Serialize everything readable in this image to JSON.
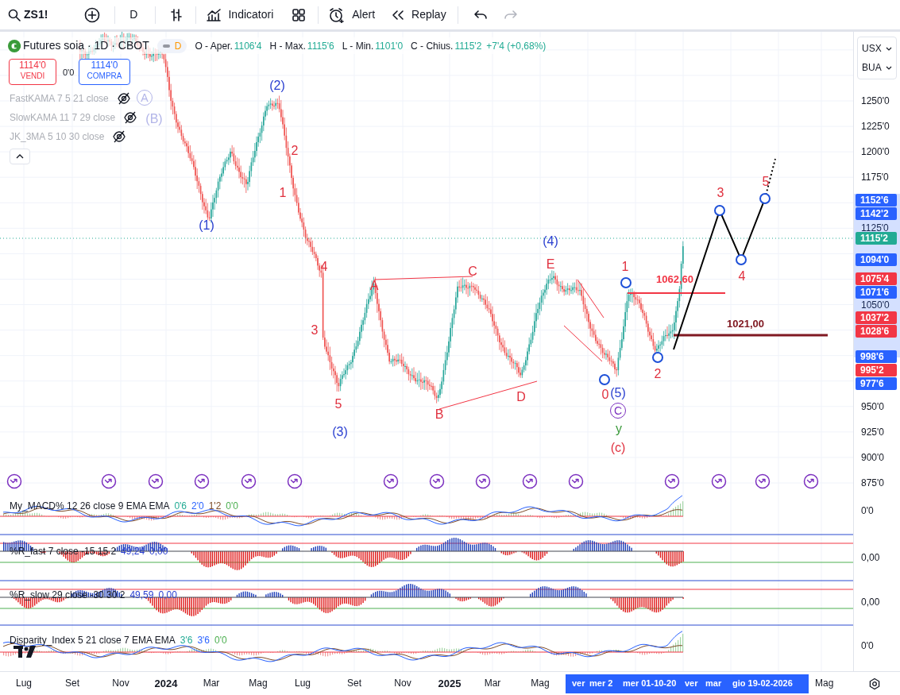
{
  "toolbar": {
    "symbol": "ZS1!",
    "interval": "D",
    "indicators": "Indicatori",
    "alert": "Alert",
    "replay": "Replay"
  },
  "legend": {
    "title": "Futures soia · 1D · CBOT",
    "badge": "D",
    "ohlc": [
      {
        "label": "O - Aper.",
        "value": "1106'4"
      },
      {
        "label": "H - Max.",
        "value": "1115'6"
      },
      {
        "label": "L - Min.",
        "value": "1101'0"
      },
      {
        "label": "C - Chius.",
        "value": "1115'2"
      }
    ],
    "change": "+7'4 (+0,68%)"
  },
  "trade": {
    "sell_price": "1114'0",
    "sell_label": "VENDI",
    "spread": "0'0",
    "buy_price": "1114'0",
    "buy_label": "COMPRA"
  },
  "studies": [
    {
      "name": "FastKAMA 7 5 21 close",
      "hidden": true
    },
    {
      "name": "SlowKAMA 11 7 29 close",
      "hidden": true
    },
    {
      "name": "JK_3MA 5 10 30 close",
      "hidden": true
    }
  ],
  "wave_labels": [
    {
      "text": "A",
      "color": "#b2b5e8",
      "kind": "circled"
    },
    {
      "text": "(B)",
      "color": "#b2b5e8",
      "kind": "plain"
    },
    {
      "text": "(2)",
      "color": "#2a3fd0",
      "kind": "plain"
    },
    {
      "text": "2",
      "color": "#e0313f",
      "kind": "plain"
    },
    {
      "text": "1",
      "color": "#e0313f",
      "kind": "plain"
    },
    {
      "text": "(1)",
      "color": "#2a3fd0",
      "kind": "plain"
    },
    {
      "text": "4",
      "color": "#e0313f",
      "kind": "plain"
    },
    {
      "text": "3",
      "color": "#e0313f",
      "kind": "plain"
    },
    {
      "text": "5",
      "color": "#e0313f",
      "kind": "plain"
    },
    {
      "text": "(3)",
      "color": "#2a3fd0",
      "kind": "plain"
    },
    {
      "text": "A",
      "color": "#e0313f",
      "kind": "plain"
    },
    {
      "text": "C",
      "color": "#e0313f",
      "kind": "plain"
    },
    {
      "text": "B",
      "color": "#e0313f",
      "kind": "plain"
    },
    {
      "text": "D",
      "color": "#e0313f",
      "kind": "plain"
    },
    {
      "text": "(4)",
      "color": "#2a3fd0",
      "kind": "plain"
    },
    {
      "text": "E",
      "color": "#e0313f",
      "kind": "plain"
    },
    {
      "text": "1",
      "color": "#e0313f",
      "kind": "plain"
    },
    {
      "text": "0",
      "color": "#e0313f",
      "kind": "plain"
    },
    {
      "text": "(5)",
      "color": "#2a3fd0",
      "kind": "plain"
    },
    {
      "text": "C",
      "color": "#7b2fbf",
      "kind": "circled"
    },
    {
      "text": "y",
      "color": "#3c9a3c",
      "kind": "plain"
    },
    {
      "text": "(c)",
      "color": "#e0313f",
      "kind": "plain"
    },
    {
      "text": "2",
      "color": "#e0313f",
      "kind": "plain"
    },
    {
      "text": "3",
      "color": "#e0313f",
      "kind": "plain"
    },
    {
      "text": "4",
      "color": "#e0313f",
      "kind": "plain"
    },
    {
      "text": "5",
      "color": "#e0313f",
      "kind": "plain"
    }
  ],
  "levels": [
    {
      "label": "1062,60",
      "color": "#f23645"
    },
    {
      "label": "1021,00",
      "color": "#801922"
    }
  ],
  "price_axis": {
    "currency": "USX",
    "unit": "BUA",
    "ticks": [
      "1250'0",
      "1225'0",
      "1200'0",
      "1175'0",
      "1125'0",
      "1050'0",
      "950'0",
      "925'0",
      "900'0",
      "875'0"
    ],
    "badges": [
      {
        "label": "1152'6",
        "color": "#2962ff"
      },
      {
        "label": "1142'2",
        "color": "#2962ff"
      },
      {
        "label": "1115'2",
        "color": "#22ab94"
      },
      {
        "label": "1094'0",
        "color": "#2962ff"
      },
      {
        "label": "1075'4",
        "color": "#f23645"
      },
      {
        "label": "1071'6",
        "color": "#2962ff"
      },
      {
        "label": "1037'2",
        "color": "#f23645"
      },
      {
        "label": "1028'6",
        "color": "#f23645"
      },
      {
        "label": "998'6",
        "color": "#2962ff"
      },
      {
        "label": "995'2",
        "color": "#f23645"
      },
      {
        "label": "977'6",
        "color": "#2962ff"
      }
    ]
  },
  "panes": [
    {
      "name": "My_MACD% 12 26 close 9 EMA EMA",
      "kind": "macd",
      "axis": "0'0",
      "values": [
        {
          "text": "0'6",
          "color": "#22ab94"
        },
        {
          "text": "2'0",
          "color": "#2962ff"
        },
        {
          "text": "1'2",
          "color": "#7f4e2a"
        },
        {
          "text": "0'0",
          "color": "#4caf50"
        }
      ]
    },
    {
      "name": "%R_fast 7 close -15 15 2",
      "kind": "bars",
      "axis": "0,00",
      "values": [
        {
          "text": "49,24",
          "color": "#2a3fd0"
        },
        {
          "text": "0,00",
          "color": "#2a3fd0"
        }
      ]
    },
    {
      "name": "%R_slow 29 close -30 30 2",
      "kind": "bars",
      "axis": "0,00",
      "values": [
        {
          "text": "49,59",
          "color": "#2a3fd0"
        },
        {
          "text": "0,00",
          "color": "#2a3fd0"
        }
      ]
    },
    {
      "name": "Disparity_Index 5 21 close 7 EMA EMA",
      "kind": "macd",
      "axis": "0'0",
      "values": [
        {
          "text": "3'6",
          "color": "#22ab94"
        },
        {
          "text": "3'6",
          "color": "#2962ff"
        },
        {
          "text": "0'0",
          "color": "#4caf50"
        }
      ]
    }
  ],
  "time_axis": {
    "labels": [
      {
        "text": "Lug",
        "kind": "month"
      },
      {
        "text": "Set",
        "kind": "month"
      },
      {
        "text": "Nov",
        "kind": "month"
      },
      {
        "text": "2024",
        "kind": "year"
      },
      {
        "text": "Mar",
        "kind": "month"
      },
      {
        "text": "Mag",
        "kind": "month"
      },
      {
        "text": "Lug",
        "kind": "month"
      },
      {
        "text": "Set",
        "kind": "month"
      },
      {
        "text": "Nov",
        "kind": "month"
      },
      {
        "text": "2025",
        "kind": "year"
      },
      {
        "text": "Mar",
        "kind": "month"
      },
      {
        "text": "Mag",
        "kind": "month"
      }
    ],
    "selection": [
      "ver",
      "mer 2",
      "mer 01-10-20",
      "ver",
      "mar",
      "gio 19-02-2026"
    ],
    "after": [
      "Mag"
    ]
  }
}
